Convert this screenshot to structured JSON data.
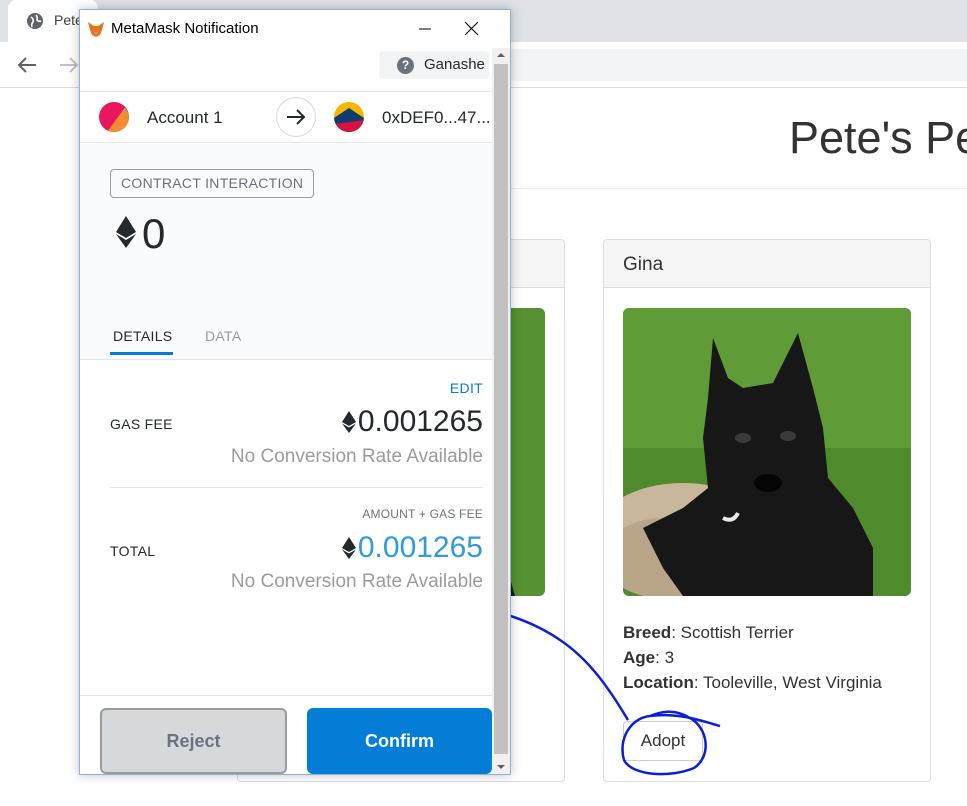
{
  "browser": {
    "tab_title": "Pete",
    "colors": {
      "tabstrip": "#dee1e6",
      "omnibox": "#f1f3f4"
    }
  },
  "page": {
    "title": "Pete's Pe",
    "pets": [
      {
        "name": "",
        "visible": "partial"
      },
      {
        "name": "Gina",
        "breed_label": "Breed",
        "breed": ": Scottish Terrier",
        "age_label": "Age",
        "age": ": 3",
        "location_label": "Location",
        "location": ": Tooleville, West Virginia",
        "button": "Adopt"
      }
    ],
    "annotation_color": "#0a1fd6"
  },
  "metamask": {
    "window_title": "MetaMask Notification",
    "network": "Ganashe",
    "from_account": "Account 1",
    "to_address": "0xDEF0...47...",
    "badge": "CONTRACT INTERACTION",
    "amount": "0",
    "tabs": {
      "details": "DETAILS",
      "data": "DATA"
    },
    "edit": "EDIT",
    "gas_fee_label": "GAS FEE",
    "gas_fee_value": "0.001265",
    "gas_fee_conversion": "No Conversion Rate Available",
    "amount_gas_label": "AMOUNT + GAS FEE",
    "total_label": "TOTAL",
    "total_value": "0.001265",
    "total_conversion": "No Conversion Rate Available",
    "reject": "Reject",
    "confirm": "Confirm",
    "colors": {
      "primary": "#037dd6",
      "total": "#2f9ae0",
      "muted": "#9b9b9b"
    }
  }
}
